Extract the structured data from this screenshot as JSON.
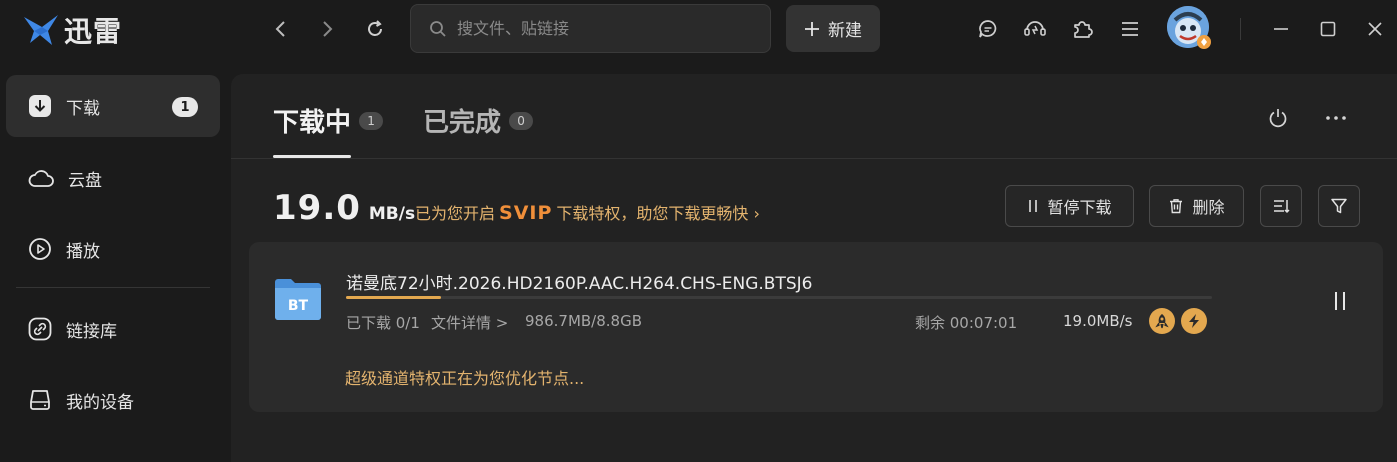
{
  "app": {
    "name": "迅雷",
    "brand_color": "#3f88e6"
  },
  "topbar": {
    "search_placeholder": "搜文件、贴链接",
    "new_button_label": "新建",
    "icons": [
      "back-icon",
      "forward-icon",
      "refresh-icon",
      "search-icon",
      "plus-icon",
      "message-icon",
      "headset-icon",
      "plugin-icon",
      "menu-icon",
      "minimize-icon",
      "maximize-icon",
      "close-icon"
    ]
  },
  "sidebar": {
    "items": [
      {
        "label": "下载",
        "icon": "download-icon",
        "badge": "1",
        "active": true
      },
      {
        "label": "云盘",
        "icon": "cloud-icon"
      },
      {
        "label": "播放",
        "icon": "play-icon"
      },
      {
        "label": "链接库",
        "icon": "link-icon"
      },
      {
        "label": "我的设备",
        "icon": "device-icon"
      }
    ]
  },
  "main": {
    "tabs": [
      {
        "label": "下载中",
        "count": "1",
        "active": true
      },
      {
        "label": "已完成",
        "count": "0",
        "active": false
      }
    ],
    "speed": {
      "value": "19.0",
      "unit": "MB/s"
    },
    "svip": {
      "prefix": "已为您开启",
      "tag": "SVIP",
      "suffix": "下载特权，助您下载更畅快 ›"
    },
    "actions": {
      "pause_all_label": "暂停下载",
      "delete_label": "删除"
    },
    "accent_color": "#e3a84f"
  },
  "task": {
    "type_label": "BT",
    "name": "诺曼底72小时.2026.HD2160P.AAC.H264.CHS-ENG.BTSJ6",
    "progress_percent": 11,
    "downloaded": "已下载 0/1",
    "details_link": "文件详情 >",
    "size": "986.7MB/8.8GB",
    "remaining": "剩余 00:07:01",
    "speed": "19.0MB/s",
    "status": "超级通道特权正在为您优化节点..."
  }
}
